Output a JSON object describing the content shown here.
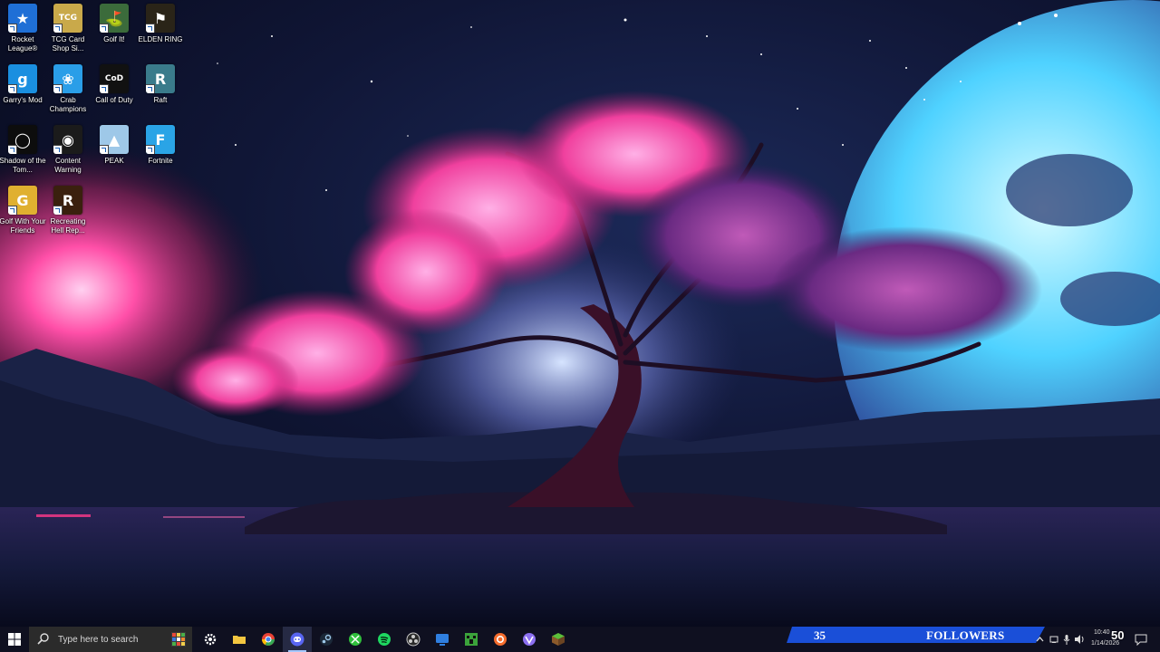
{
  "desktop": {
    "icons": [
      {
        "label": "Rocket League®",
        "icon": "rocket-league-icon",
        "color": "#1f6fd6"
      },
      {
        "label": "TCG Card Shop Si...",
        "icon": "tcg-card-shop-icon",
        "color": "#c9a94a"
      },
      {
        "label": "Golf It!",
        "icon": "golf-it-icon",
        "color": "#3b6b3b"
      },
      {
        "label": "ELDEN RING",
        "icon": "elden-ring-icon",
        "color": "#2a2418"
      },
      {
        "label": "Garry's Mod",
        "icon": "garrys-mod-icon",
        "color": "#1a8fe0"
      },
      {
        "label": "Crab Champions",
        "icon": "crab-champions-icon",
        "color": "#2a9ee8"
      },
      {
        "label": "Call of Duty",
        "icon": "call-of-duty-icon",
        "color": "#111111"
      },
      {
        "label": "Raft",
        "icon": "raft-icon",
        "color": "#3a7b8b"
      },
      {
        "label": "Shadow of the Tom...",
        "icon": "shadow-of-the-tomb-raider-icon",
        "color": "#0d0d0d"
      },
      {
        "label": "Content Warning",
        "icon": "content-warning-icon",
        "color": "#1b1b1b"
      },
      {
        "label": "PEAK",
        "icon": "peak-icon",
        "color": "#9ec8e8"
      },
      {
        "label": "Fortnite",
        "icon": "fortnite-icon",
        "color": "#2aa4e6"
      },
      {
        "label": "Golf With Your Friends",
        "icon": "golf-with-your-friends-icon",
        "color": "#e0b030"
      },
      {
        "label": "Recreating Hell Rep...",
        "icon": "recreating-hell-icon",
        "color": "#3a200e"
      }
    ]
  },
  "taskbar": {
    "search_placeholder": "Type here to search",
    "apps": [
      {
        "name": "settings",
        "icon": "gear-icon",
        "color": "#ffffff"
      },
      {
        "name": "file-explorer",
        "icon": "folder-icon",
        "color": "#f3c640"
      },
      {
        "name": "chrome",
        "icon": "chrome-icon",
        "color": "#e94235"
      },
      {
        "name": "discord",
        "icon": "discord-icon",
        "color": "#5865f2",
        "active": true
      },
      {
        "name": "steam",
        "icon": "steam-icon",
        "color": "#9ec7e8"
      },
      {
        "name": "xbox",
        "icon": "xbox-icon",
        "color": "#2fbf3b"
      },
      {
        "name": "spotify",
        "icon": "spotify-icon",
        "color": "#1ed760"
      },
      {
        "name": "obs",
        "icon": "obs-icon",
        "color": "#cccccc"
      },
      {
        "name": "remote",
        "icon": "remote-desktop-icon",
        "color": "#2f7fe0"
      },
      {
        "name": "minecraft",
        "icon": "creeper-icon",
        "color": "#3ba33b"
      },
      {
        "name": "origin",
        "icon": "origin-icon",
        "color": "#f56c2d"
      },
      {
        "name": "vpn",
        "icon": "proton-vpn-icon",
        "color": "#8b6ff0"
      },
      {
        "name": "minecraft-launcher",
        "icon": "grass-block-icon",
        "color": "#5cbf3a"
      }
    ],
    "tray_icons": [
      "network-icon",
      "microphone-icon",
      "volume-icon",
      "chevron-up-icon"
    ],
    "clock": {
      "time": "10:40",
      "date": "1/14/2026"
    }
  },
  "followers_bar": {
    "count": "35",
    "label": "FOLLOWERS",
    "overlay_number": "50",
    "color": "#1a4fd8"
  }
}
